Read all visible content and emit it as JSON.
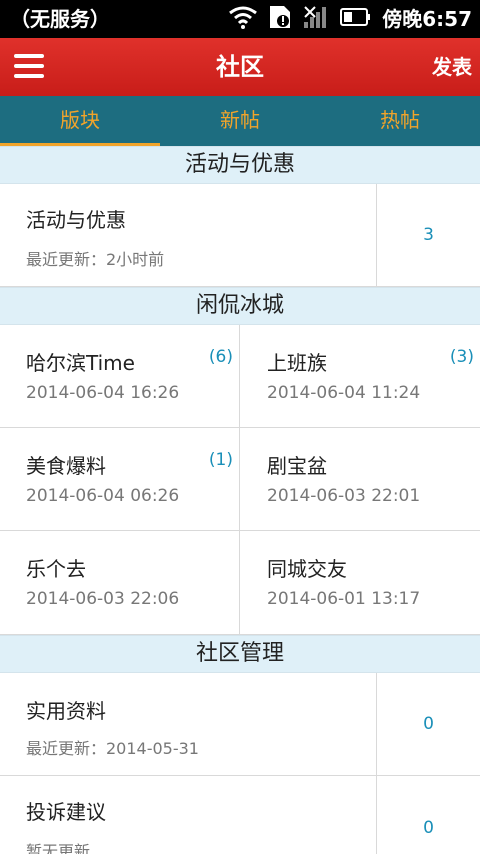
{
  "status_bar": {
    "carrier": "（无服务）",
    "time": "傍晚6:57"
  },
  "header": {
    "title": "社区",
    "post_label": "发表"
  },
  "tabs": [
    {
      "label": "版块",
      "active": true
    },
    {
      "label": "新帖",
      "active": false
    },
    {
      "label": "热帖",
      "active": false
    }
  ],
  "sections": [
    {
      "title": "活动与优惠",
      "items": [
        {
          "title": "活动与优惠",
          "subtitle": "最近更新：2小时前",
          "count": "3"
        }
      ]
    },
    {
      "title": "闲侃冰城",
      "grid": [
        {
          "title": "哈尔滨Time",
          "date": "2014-06-04 16:26",
          "count": "(6)"
        },
        {
          "title": "上班族",
          "date": "2014-06-04 11:24",
          "count": "(3)"
        },
        {
          "title": "美食爆料",
          "date": "2014-06-04 06:26",
          "count": "(1)"
        },
        {
          "title": "剧宝盆",
          "date": "2014-06-03 22:01",
          "count": ""
        },
        {
          "title": "乐个去",
          "date": "2014-06-03 22:06",
          "count": ""
        },
        {
          "title": "同城交友",
          "date": "2014-06-01 13:17",
          "count": ""
        }
      ]
    },
    {
      "title": "社区管理",
      "items": [
        {
          "title": "实用资料",
          "subtitle": "最近更新：2014-05-31",
          "count": "0"
        },
        {
          "title": "投诉建议",
          "subtitle": "暂无更新",
          "count": "0"
        }
      ]
    }
  ],
  "colors": {
    "header_red": "#d42420",
    "tab_bar": "#1d6d80",
    "tab_text": "#f1a42a",
    "section_bg": "#dff0f8",
    "count_blue": "#1a8fb8"
  }
}
